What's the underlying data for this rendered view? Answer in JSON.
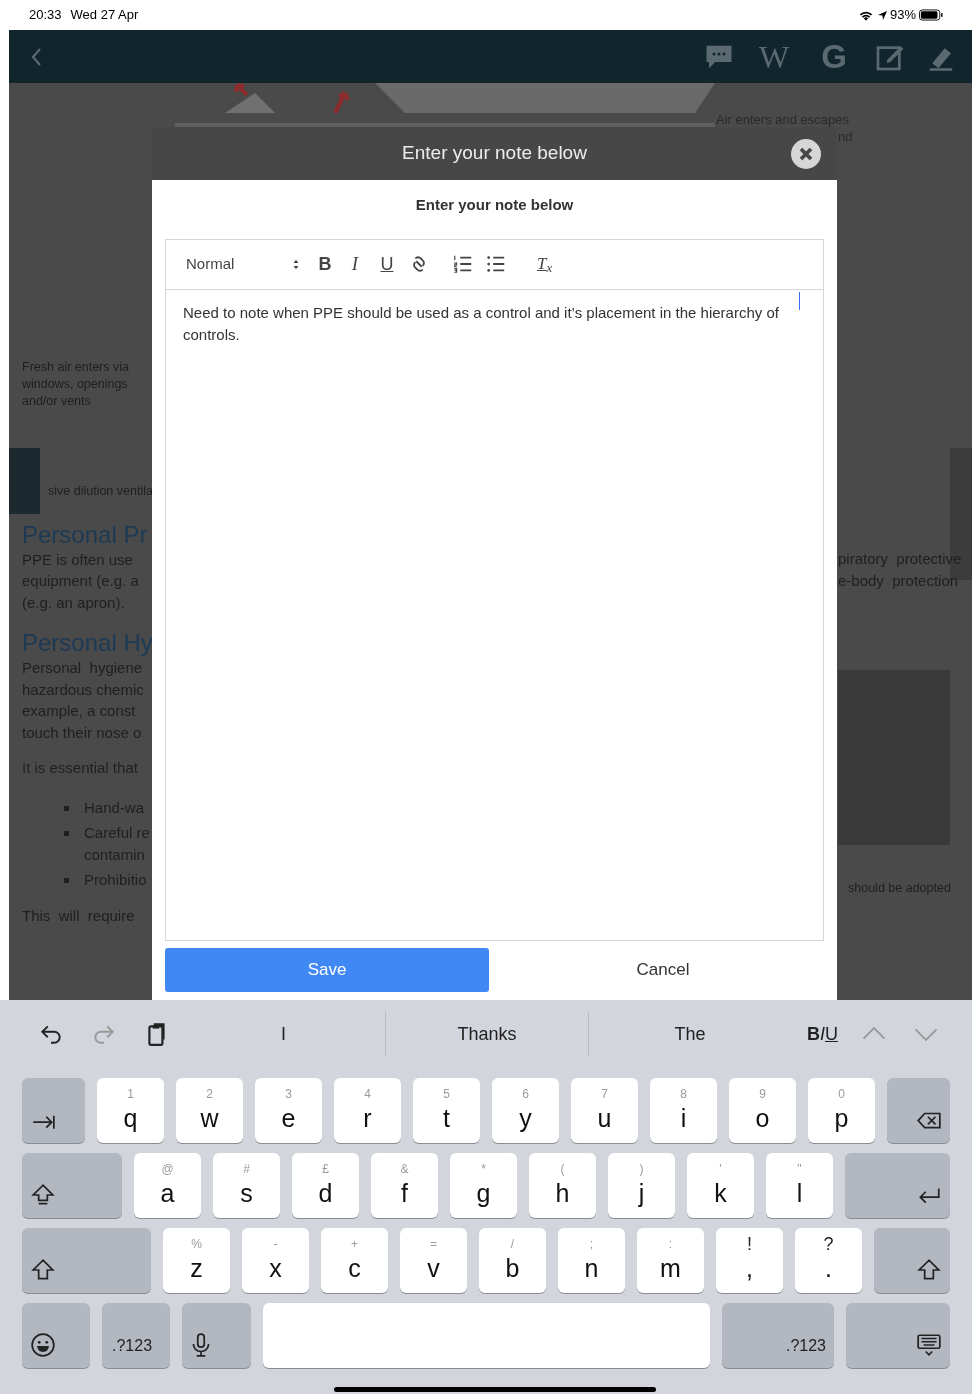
{
  "status_bar": {
    "time": "20:33",
    "date": "Wed 27 Apr",
    "battery": "93%"
  },
  "nav_bar": {
    "buttons": [
      {
        "kind": "back"
      },
      {
        "kind": "comment"
      },
      {
        "kind": "letter",
        "label": "W"
      },
      {
        "kind": "letter",
        "label": "G"
      },
      {
        "kind": "note"
      },
      {
        "kind": "highlighter"
      }
    ]
  },
  "background": {
    "top_caption": "Air enters and escapes",
    "top_caption_end": "nd",
    "left_caption": [
      "Fresh air enters via",
      "windows, openings",
      "and/or vents"
    ],
    "figure_caption": "sive dilution ventila",
    "blocks": [
      {
        "kind": "heading",
        "lines": [
          "Personal Pr"
        ]
      },
      {
        "kind": "para",
        "lines": [
          "PPE is often use",
          "equipment (e.g. a",
          "(e.g. an apron)."
        ]
      },
      {
        "kind": "heading",
        "lines": [
          "Personal Hy"
        ]
      },
      {
        "kind": "para",
        "lines": [
          "Personal  hygiene",
          "hazardous chemic",
          "example, a const",
          "touch their nose o"
        ]
      },
      {
        "kind": "para",
        "lines": [
          "It is essential that"
        ]
      },
      {
        "kind": "bullets",
        "items": [
          [
            "Hand-wa"
          ],
          [
            "Careful re",
            "contamin"
          ],
          [
            "Prohibitio"
          ]
        ]
      },
      {
        "kind": "para",
        "lines": [
          "This  will  require"
        ]
      }
    ],
    "right_lines": [
      "piratory  protective",
      "e-body  protection"
    ],
    "right_caption": "should be adopted"
  },
  "modal": {
    "title": "Enter your note below",
    "subtitle": "Enter your note below",
    "editor": {
      "format_select": "Normal",
      "tools": [
        {
          "kind": "bold",
          "label": "B"
        },
        {
          "kind": "italic",
          "label": "I"
        },
        {
          "kind": "underline",
          "label": "U"
        },
        {
          "kind": "link"
        },
        {
          "kind": "ordered"
        },
        {
          "kind": "bullet"
        },
        {
          "kind": "clean",
          "label": "T$_{x}$"
        }
      ],
      "text": "Need to note when PPE should be used as a control and it’s placement in the hierarchy of controls."
    },
    "buttons": [
      {
        "kind": "primary",
        "label": "Save"
      },
      {
        "kind": "plain",
        "label": "Cancel"
      }
    ]
  },
  "keyboard": {
    "suggestions": [
      "I",
      "Thanks",
      "The"
    ],
    "format": [
      {
        "kind": "bold",
        "label": "B"
      },
      {
        "kind": "italic",
        "label": "I"
      },
      {
        "kind": "underline",
        "label": "U"
      }
    ],
    "rows": [
      [
        {
          "kind": "tab"
        },
        {
          "kind": "char",
          "hint": "1",
          "label": "q"
        },
        {
          "kind": "char",
          "hint": "2",
          "label": "w"
        },
        {
          "kind": "char",
          "hint": "3",
          "label": "e"
        },
        {
          "kind": "char",
          "hint": "4",
          "label": "r"
        },
        {
          "kind": "char",
          "hint": "5",
          "label": "t"
        },
        {
          "kind": "char",
          "hint": "6",
          "label": "y"
        },
        {
          "kind": "char",
          "hint": "7",
          "label": "u"
        },
        {
          "kind": "char",
          "hint": "8",
          "label": "i"
        },
        {
          "kind": "char",
          "hint": "9",
          "label": "o"
        },
        {
          "kind": "char",
          "hint": "0",
          "label": "p"
        },
        {
          "kind": "delete"
        }
      ],
      [
        {
          "kind": "caps"
        },
        {
          "kind": "char",
          "hint": "@",
          "label": "a"
        },
        {
          "kind": "char",
          "hint": "#",
          "label": "s"
        },
        {
          "kind": "char",
          "hint": "£",
          "label": "d"
        },
        {
          "kind": "char",
          "hint": "&",
          "label": "f"
        },
        {
          "kind": "char",
          "hint": "*",
          "label": "g"
        },
        {
          "kind": "char",
          "hint": "(",
          "label": "h"
        },
        {
          "kind": "char",
          "hint": ")",
          "label": "j"
        },
        {
          "kind": "char",
          "hint": "'",
          "label": "k"
        },
        {
          "kind": "char",
          "hint": "\"",
          "label": "l"
        },
        {
          "kind": "return"
        }
      ],
      [
        {
          "kind": "shift"
        },
        {
          "kind": "char",
          "hint": "%",
          "label": "z"
        },
        {
          "kind": "char",
          "hint": "-",
          "label": "x"
        },
        {
          "kind": "char",
          "hint": "+",
          "label": "c"
        },
        {
          "kind": "char",
          "hint": "=",
          "label": "v"
        },
        {
          "kind": "char",
          "hint": "/",
          "label": "b"
        },
        {
          "kind": "char",
          "hint": ";",
          "label": "n"
        },
        {
          "kind": "char",
          "hint": ":",
          "label": "m"
        },
        {
          "kind": "punct",
          "hint": "!",
          "label": ","
        },
        {
          "kind": "punct",
          "hint": "?",
          "label": "."
        },
        {
          "kind": "shift"
        }
      ],
      [
        {
          "kind": "emoji"
        },
        {
          "kind": "mode",
          "label": ".?123"
        },
        {
          "kind": "mic"
        },
        {
          "kind": "space"
        },
        {
          "kind": "mode",
          "label": ".?123"
        },
        {
          "kind": "hide"
        }
      ]
    ]
  }
}
